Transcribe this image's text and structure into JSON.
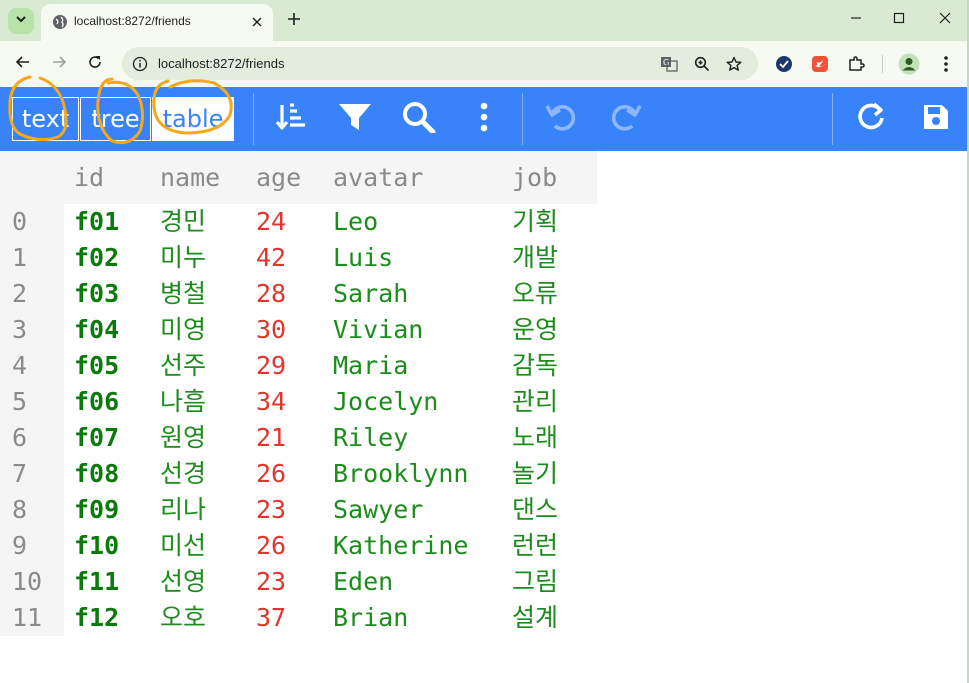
{
  "browser": {
    "tab_title": "localhost:8272/friends",
    "url": "localhost:8272/friends",
    "icons": [
      "tab-search-icon",
      "globe-icon",
      "close-icon",
      "plus-icon",
      "minimize-icon",
      "maximize-icon",
      "close-window-icon",
      "back-icon",
      "forward-icon",
      "reload-icon",
      "info-icon",
      "translate-icon",
      "zoom-icon",
      "star-icon",
      "check-extension-icon",
      "swift-extension-icon",
      "puzzle-icon",
      "profile-icon",
      "more-vert-icon"
    ]
  },
  "toolbar": {
    "modes": [
      {
        "label": "text",
        "active": false
      },
      {
        "label": "tree",
        "active": false
      },
      {
        "label": "table",
        "active": true
      }
    ],
    "icons": [
      "sort-icon",
      "filter-icon",
      "search-icon",
      "more-icon",
      "undo-icon",
      "redo-icon",
      "refresh-icon",
      "save-icon"
    ],
    "color": "#3883fa"
  },
  "table": {
    "columns": [
      "id",
      "name",
      "age",
      "avatar",
      "job"
    ],
    "rows": [
      {
        "index": "0",
        "id": "f01",
        "name": "경민",
        "age": "24",
        "avatar": "Leo",
        "job": "기획"
      },
      {
        "index": "1",
        "id": "f02",
        "name": "미누",
        "age": "42",
        "avatar": "Luis",
        "job": "개발"
      },
      {
        "index": "2",
        "id": "f03",
        "name": "병철",
        "age": "28",
        "avatar": "Sarah",
        "job": "오류"
      },
      {
        "index": "3",
        "id": "f04",
        "name": "미영",
        "age": "30",
        "avatar": "Vivian",
        "job": "운영"
      },
      {
        "index": "4",
        "id": "f05",
        "name": "선주",
        "age": "29",
        "avatar": "Maria",
        "job": "감독"
      },
      {
        "index": "5",
        "id": "f06",
        "name": "나흠",
        "age": "34",
        "avatar": "Jocelyn",
        "job": "관리"
      },
      {
        "index": "6",
        "id": "f07",
        "name": "원영",
        "age": "21",
        "avatar": "Riley",
        "job": "노래"
      },
      {
        "index": "7",
        "id": "f08",
        "name": "선경",
        "age": "26",
        "avatar": "Brooklynn",
        "job": "놀기"
      },
      {
        "index": "8",
        "id": "f09",
        "name": "리나",
        "age": "23",
        "avatar": "Sawyer",
        "job": "댄스"
      },
      {
        "index": "9",
        "id": "f10",
        "name": "미선",
        "age": "26",
        "avatar": "Katherine",
        "job": "런런"
      },
      {
        "index": "10",
        "id": "f11",
        "name": "선영",
        "age": "23",
        "avatar": "Eden",
        "job": "그림"
      },
      {
        "index": "11",
        "id": "f12",
        "name": "오호",
        "age": "37",
        "avatar": "Brian",
        "job": "설계"
      }
    ],
    "colors": {
      "key": "#0b7a0b",
      "string": "#1d8c1d",
      "number": "#e2352f",
      "index": "#8a8a8a"
    }
  }
}
